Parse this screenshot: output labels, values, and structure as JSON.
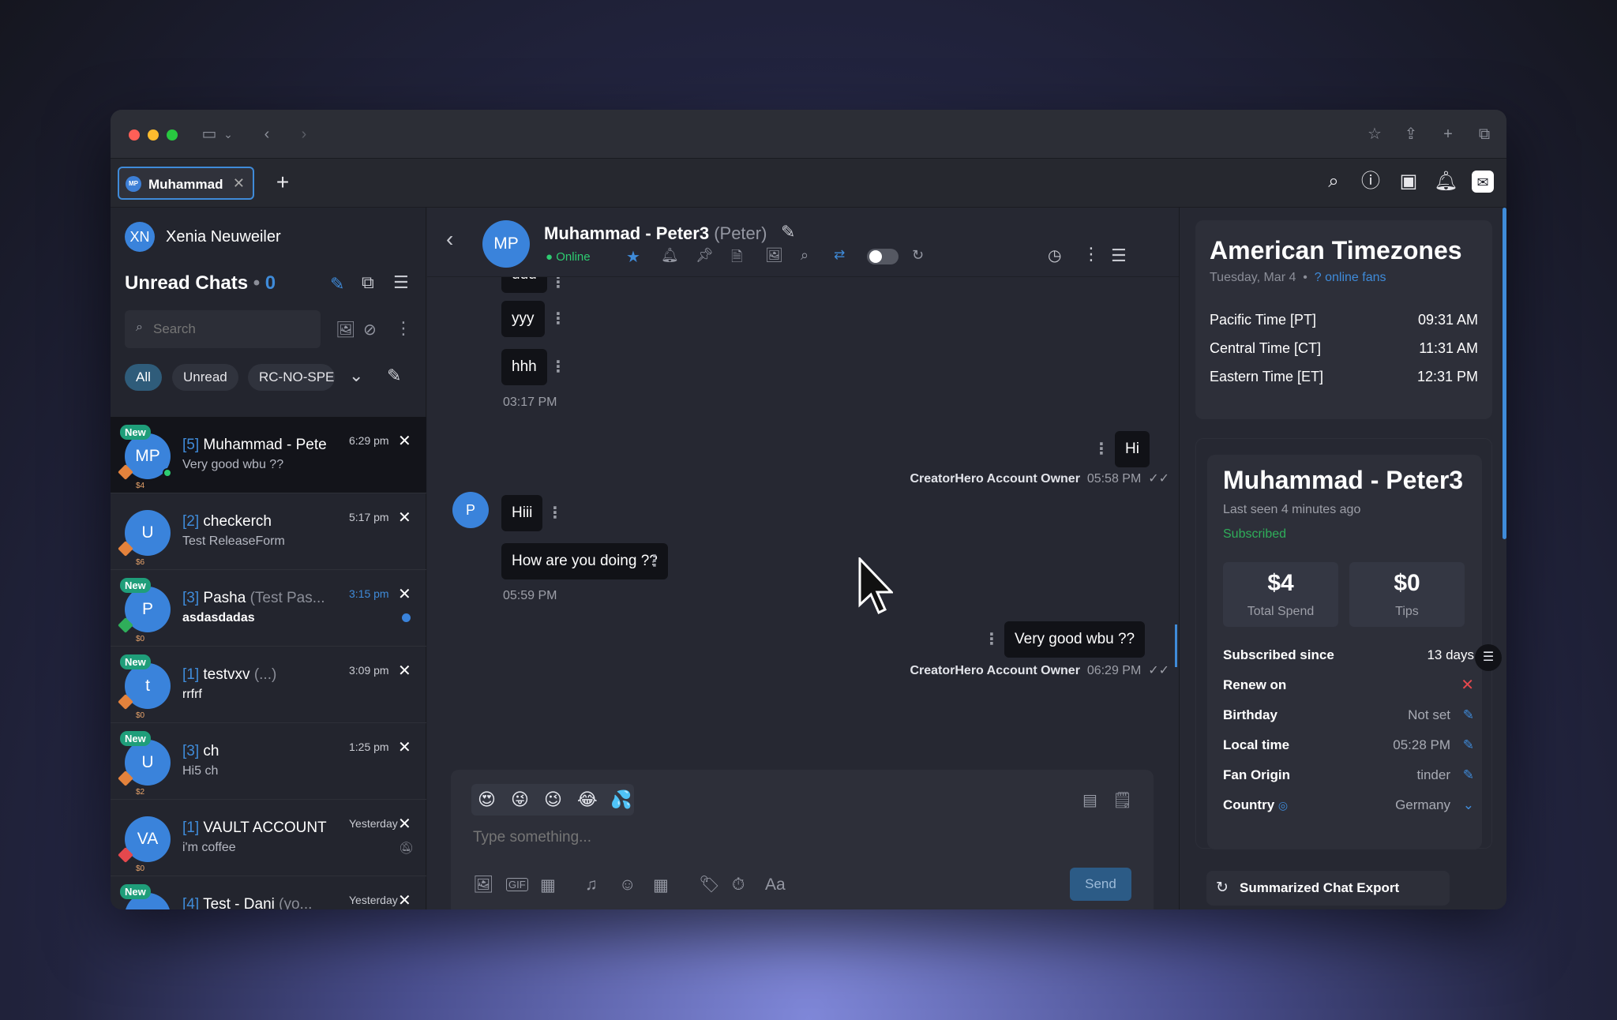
{
  "tab": {
    "avatar": "MP",
    "label": "Muhammad",
    "close": "✕"
  },
  "sidebar": {
    "user": {
      "initials": "XN",
      "name": "Xenia Neuweiler"
    },
    "unread_title": "Unread Chats",
    "unread_count": "0",
    "search_placeholder": "Search",
    "filters": [
      "All",
      "Unread",
      "RC-NO-SPE"
    ],
    "chats": [
      {
        "new": "New",
        "initials": "MP",
        "spend": "$4",
        "count": "[5]",
        "name": "Muhammad - Pete",
        "extra": "",
        "time": "6:29 pm",
        "preview": "Very good wbu ??"
      },
      {
        "new": "",
        "initials": "U",
        "spend": "$6",
        "count": "[2]",
        "name": "checkerch",
        "extra": "",
        "time": "5:17 pm",
        "preview": "Test ReleaseForm"
      },
      {
        "new": "New",
        "initials": "P",
        "spend": "$0",
        "count": "[3]",
        "name": "Pasha",
        "extra": "(Test Pas...",
        "time": "3:15 pm",
        "preview": "asdasdadas"
      },
      {
        "new": "New",
        "initials": "t",
        "spend": "$0",
        "count": "[1]",
        "name": "testvxv",
        "extra": "(...)",
        "time": "3:09 pm",
        "preview": "rrfrf"
      },
      {
        "new": "New",
        "initials": "U",
        "spend": "$2",
        "count": "[3]",
        "name": "ch",
        "extra": "",
        "time": "1:25 pm",
        "preview": "Hi5 ch"
      },
      {
        "new": "",
        "initials": "VA",
        "spend": "$0",
        "count": "[1]",
        "name": "VAULT ACCOUNT",
        "extra": "",
        "time": "Yesterday",
        "preview": "i'm coffee"
      },
      {
        "new": "New",
        "initials": "",
        "spend": "",
        "count": "[4]",
        "name": "Test - Dani",
        "extra": "(yo...",
        "time": "Yesterday",
        "preview": ""
      }
    ]
  },
  "chat": {
    "avatar": "MP",
    "title": "Muhammad - Peter3",
    "nickname": "(Peter)",
    "status": "Online",
    "messages_in_top": [
      "uuu",
      "yyy",
      "hhh"
    ],
    "time_1": "03:17 PM",
    "out_1": "Hi",
    "out_1_meta": "CreatorHero Account Owner",
    "out_1_time": "05:58 PM",
    "fan_avatar": "P",
    "in_2": "Hiii",
    "in_3": "How are you doing ??",
    "time_2": "05:59 PM",
    "out_2": "Very good wbu ??",
    "out_2_meta": "CreatorHero Account Owner",
    "out_2_time": "06:29 PM",
    "emojis": [
      "😍",
      "😜",
      "😉",
      "😂",
      "💦"
    ],
    "input_placeholder": "Type something...",
    "send_label": "Send"
  },
  "timezones": {
    "title": "American Timezones",
    "date": "Tuesday, Mar 4",
    "online": "? online fans",
    "rows": [
      {
        "zone": "Pacific Time [PT]",
        "time": "09:31 AM"
      },
      {
        "zone": "Central Time [CT]",
        "time": "11:31 AM"
      },
      {
        "zone": "Eastern Time [ET]",
        "time": "12:31 PM"
      }
    ]
  },
  "fan": {
    "name": "Muhammad - Peter3",
    "last_seen": "Last seen 4 minutes ago",
    "status": "Subscribed",
    "total_spend": "$4",
    "total_spend_label": "Total Spend",
    "tips": "$0",
    "tips_label": "Tips",
    "subscribed_since_label": "Subscribed since",
    "subscribed_since": "13 days",
    "renew_label": "Renew on",
    "birthday_label": "Birthday",
    "birthday": "Not set",
    "local_time_label": "Local time",
    "local_time": "05:28 PM",
    "origin_label": "Fan Origin",
    "origin": "tinder",
    "country_label": "Country",
    "country": "Germany",
    "export_label": "Summarized Chat Export"
  },
  "colors": {
    "accent": "#3f8bd9",
    "online": "#2ecc71",
    "subscribed": "#2fae5a",
    "danger": "#e5484d"
  }
}
